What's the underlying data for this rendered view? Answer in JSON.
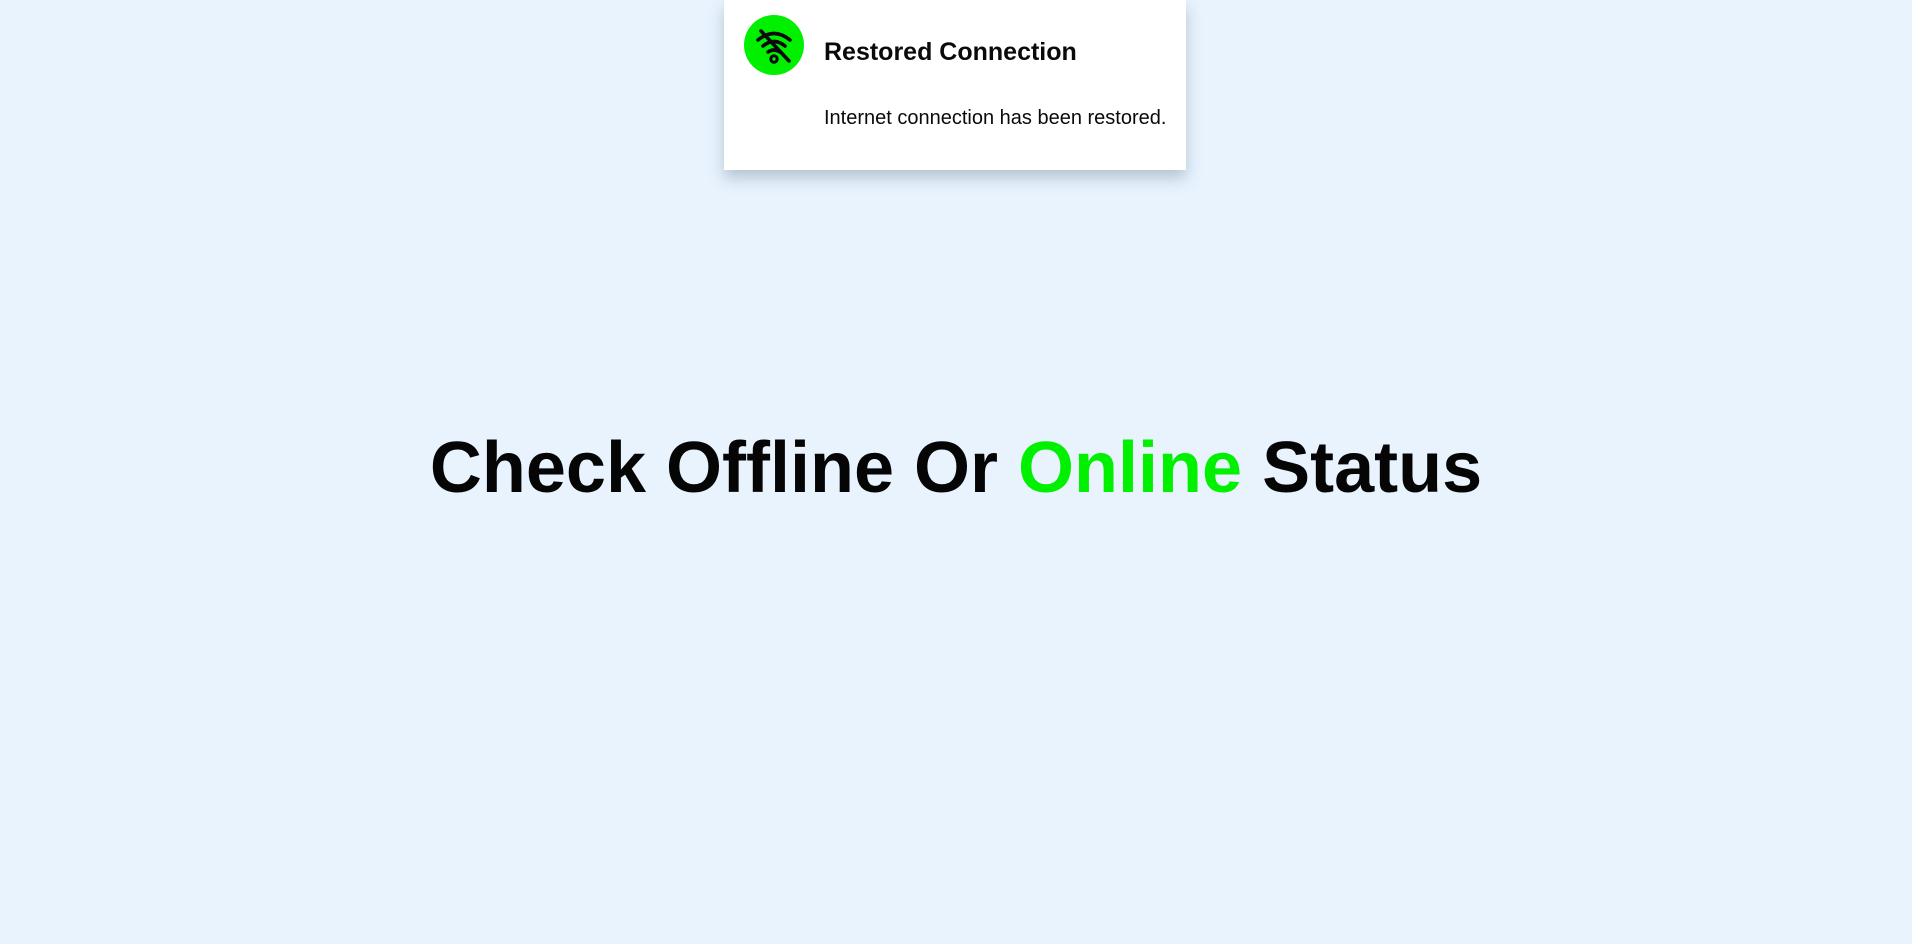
{
  "toast": {
    "icon": "wifi-off-icon",
    "title": "Restored Connection",
    "message": "Internet connection has been restored."
  },
  "heading": {
    "part1": "Check Offline Or",
    "accent": "Online",
    "part2": "Status"
  },
  "colors": {
    "background": "#e8f3fe",
    "accent": "#00f000",
    "toast_bg": "#ffffff",
    "text": "#050505"
  }
}
